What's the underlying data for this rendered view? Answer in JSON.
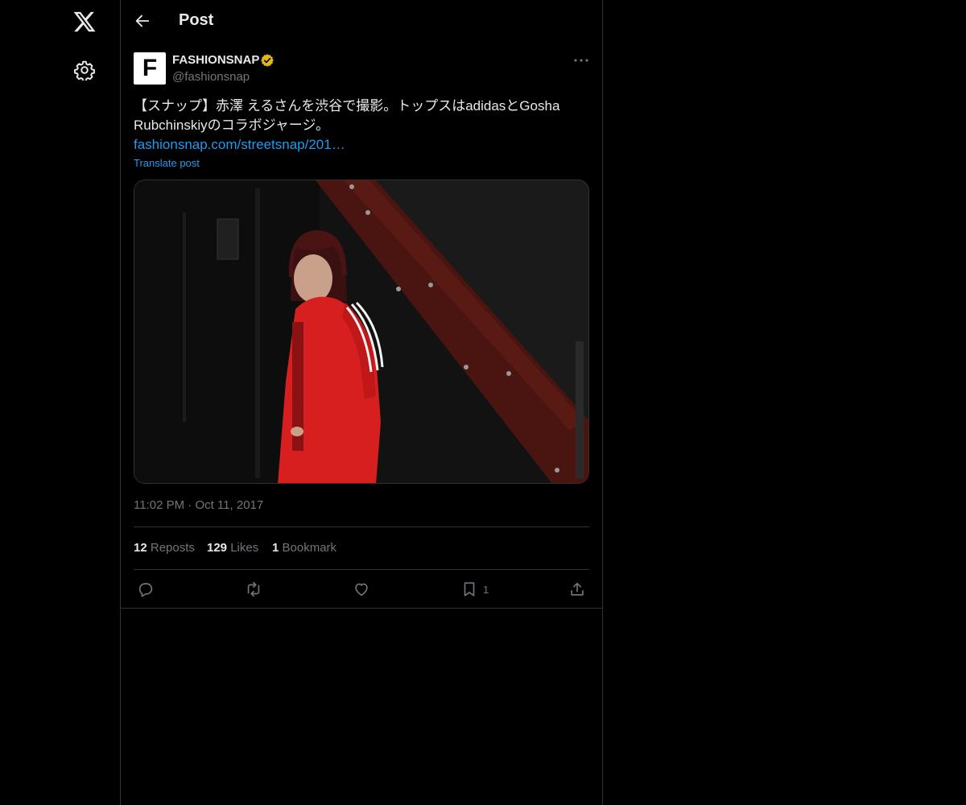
{
  "header": {
    "title": "Post"
  },
  "author": {
    "avatar_letter": "F",
    "display_name": "FASHIONSNAP",
    "handle": "@fashionsnap"
  },
  "tweet": {
    "text": "【スナップ】赤澤 えるさんを渋谷で撮影。トップスはadidasとGosha Rubchinskiyのコラボジャージ。",
    "link": "fashionsnap.com/streetsnap/201…",
    "translate_label": "Translate post",
    "time": "11:02 PM",
    "date": "Oct 11, 2017"
  },
  "stats": {
    "reposts_count": "12",
    "reposts_label": "Reposts",
    "likes_count": "129",
    "likes_label": "Likes",
    "bookmarks_count": "1",
    "bookmarks_label": "Bookmark"
  },
  "actions": {
    "bookmark_count": "1"
  },
  "icons": [
    "x-logo-icon",
    "gear-icon",
    "back-arrow-icon",
    "verified-badge-icon",
    "more-icon",
    "reply-icon",
    "repost-icon",
    "like-icon",
    "bookmark-icon",
    "share-icon"
  ],
  "colors": {
    "accent": "#1d9bf0",
    "verified": "#e2b719",
    "secondary_text": "#71767b"
  }
}
